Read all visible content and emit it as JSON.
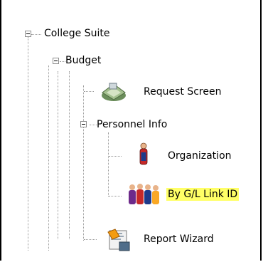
{
  "tree": {
    "root": {
      "label": "College Suite",
      "expanded": true
    },
    "budget": {
      "label": "Budget",
      "expanded": true
    },
    "request_screen": {
      "label": "Request Screen",
      "icon": "request-screen-icon"
    },
    "personnel_info": {
      "label": "Personnel Info",
      "expanded": true
    },
    "organization": {
      "label": "Organization",
      "icon": "organization-icon"
    },
    "by_gl_link_id": {
      "label": "By G/L Link ID",
      "icon": "gl-link-icon",
      "selected": true,
      "highlight_color": "#ffff66"
    },
    "report_wizard": {
      "label": "Report Wizard",
      "icon": "report-wizard-icon"
    }
  }
}
